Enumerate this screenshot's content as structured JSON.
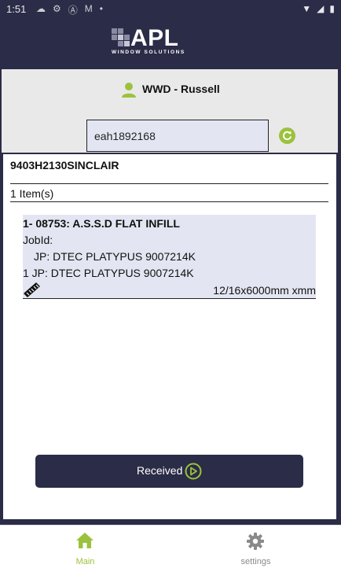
{
  "status_bar": {
    "time": "1:51",
    "notification_icons": [
      "cloud-icon",
      "gear-icon",
      "a-icon",
      "gmail-icon",
      "dot-icon"
    ],
    "system_icons": [
      "wifi-icon",
      "signal-icon",
      "battery-icon"
    ]
  },
  "brand": {
    "logo_text": "APL",
    "logo_subtext": "WINDOW SOLUTIONS",
    "primary_color": "#2b2c47",
    "accent_color": "#9bc23c"
  },
  "header": {
    "user_name": "WWD - Russell",
    "search_value": "eah1892168"
  },
  "order": {
    "id": "9403H2130SINCLAIR",
    "item_count": "1 Item(s)",
    "items": [
      {
        "title": "1- 08753: A.S.S.D FLAT INFILL",
        "job_label": "JobId:",
        "job_line_1": "JP: DTEC PLATYPUS 9007214K",
        "job_line_2": "1  JP: DTEC PLATYPUS 9007214K",
        "dimensions": "12/16x6000mm xmm"
      }
    ]
  },
  "actions": {
    "received_label": "Received"
  },
  "bottom_nav": [
    {
      "label": "Main",
      "icon": "home-icon",
      "active": true
    },
    {
      "label": "settings",
      "icon": "gear-icon",
      "active": false
    }
  ]
}
